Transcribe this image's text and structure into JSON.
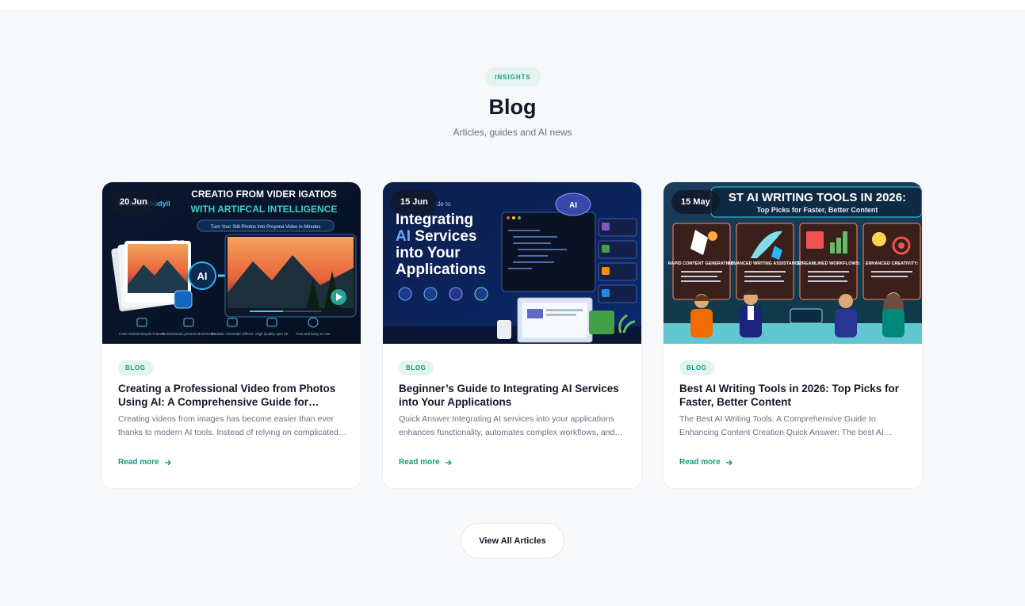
{
  "section": {
    "eyebrow": "INSIGHTS",
    "title": "Blog",
    "subtitle": "Articles, guides and AI news",
    "accent_color": "#199a7e"
  },
  "cards": [
    {
      "date": "20 Jun",
      "tag": "BLOG",
      "title": "Creating a Professional Video from Photos Using AI: A Comprehensive Guide for Beginners",
      "excerpt": "Creating videos from images has become easier than ever thanks to modern AI tools. Instead of relying on complicated editing software",
      "read_more": "Read more",
      "image": {
        "headline_1": "CREATIO FROM VIDER IGATIOS",
        "headline_2": "WITH ARTIFCAL INTELLIGENCE",
        "strapline": "Turn Your Still Photos into Proyona Video in Minutes",
        "author": "Dalil Al-Ahedyil",
        "ai_label": "AI",
        "features": [
          "Fram Oriend Mevple Frames",
          "Professianal Lyresma Movements",
          "Realistic Cinematic Effects",
          "High Quality upto 4K",
          "Fast and Easy to Use"
        ]
      }
    },
    {
      "date": "15 Jun",
      "tag": "BLOG",
      "title": "Beginner’s Guide to Integrating AI Services into Your Applications",
      "excerpt": "Quick Answer:Integrating AI services into your applications enhances functionality, automates complex workflows, and improves user experience",
      "read_more": "Read more",
      "image": {
        "kicker": "ide to",
        "line_1": "Integrating",
        "line_2a": "AI",
        "line_2b": " Services",
        "line_3": "into Your",
        "line_4": "Applications",
        "ai_label": "AI"
      }
    },
    {
      "date": "15 May",
      "tag": "BLOG",
      "title": "Best AI Writing Tools in 2026: Top Picks for Faster, Better Content",
      "excerpt": "The Best AI Writing Tools: A Comprehensive Guide to Enhancing Content Creation Quick Answer: The best AI writing tools",
      "read_more": "Read more",
      "image": {
        "headline": "ST AI WRITING TOOLS IN 2026:",
        "subhead": "Top Picks for Faster, Better Content",
        "panels": [
          "RAPID CONTENT GENERATION:",
          "ADVANCED WRITING ASSISTANCE:",
          "STREAMLINED WORKFLOWS:",
          "ENHANCED CREATIVITY:"
        ]
      }
    }
  ],
  "view_all": "View All Articles"
}
